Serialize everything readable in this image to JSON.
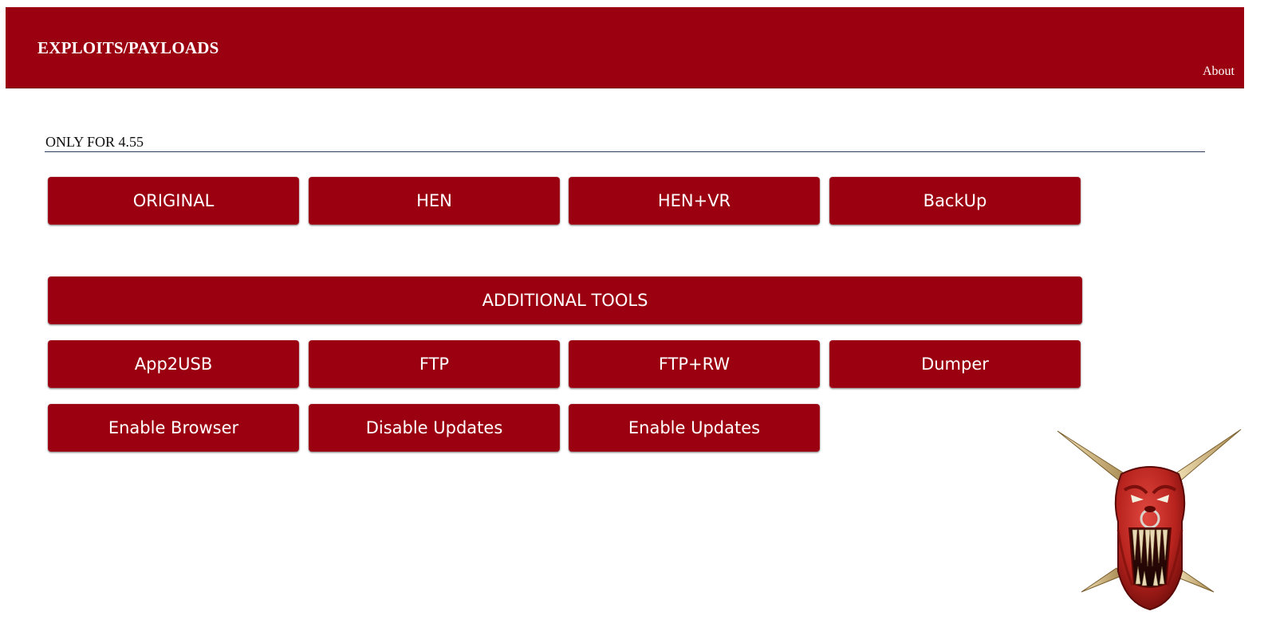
{
  "header": {
    "title": "EXPLOITS/PAYLOADS",
    "about_label": "About"
  },
  "section": {
    "label": "ONLY FOR 4.55"
  },
  "payloads": [
    {
      "label": "ORIGINAL"
    },
    {
      "label": "HEN"
    },
    {
      "label": "HEN+VR"
    },
    {
      "label": "BackUp"
    }
  ],
  "tools": {
    "header_label": "ADDITIONAL TOOLS",
    "row1": [
      {
        "label": "App2USB"
      },
      {
        "label": "FTP"
      },
      {
        "label": "FTP+RW"
      },
      {
        "label": "Dumper"
      }
    ],
    "row2": [
      {
        "label": "Enable Browser"
      },
      {
        "label": "Disable Updates"
      },
      {
        "label": "Enable Updates"
      }
    ]
  },
  "mascot": {
    "icon": "horned-demon-head-icon"
  },
  "colors": {
    "accent": "#9b0010",
    "text_on_accent": "#ffffff",
    "rule": "#2b3d57"
  }
}
